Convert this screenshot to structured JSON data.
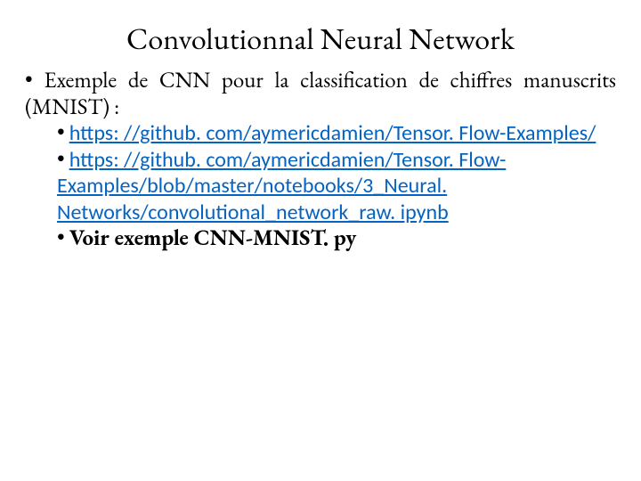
{
  "title": "Convolutionnal Neural Network",
  "body": {
    "item1_bullet": "• ",
    "item1": "Exemple de CNN pour la classification de chiffres manuscrits (MNIST) :",
    "sub1_bullet": "• ",
    "link1": "https: //github. com/aymericdamien/Tensor. Flow-Examples/",
    "sub2_bullet": "• ",
    "link2": "https: //github. com/aymericdamien/Tensor. Flow-Examples/blob/master/notebooks/3_Neural. Networks/convolutional_network_raw. ipynb",
    "sub3_bullet": "• ",
    "sub3_text": "Voir exemple CNN-MNIST. py"
  }
}
